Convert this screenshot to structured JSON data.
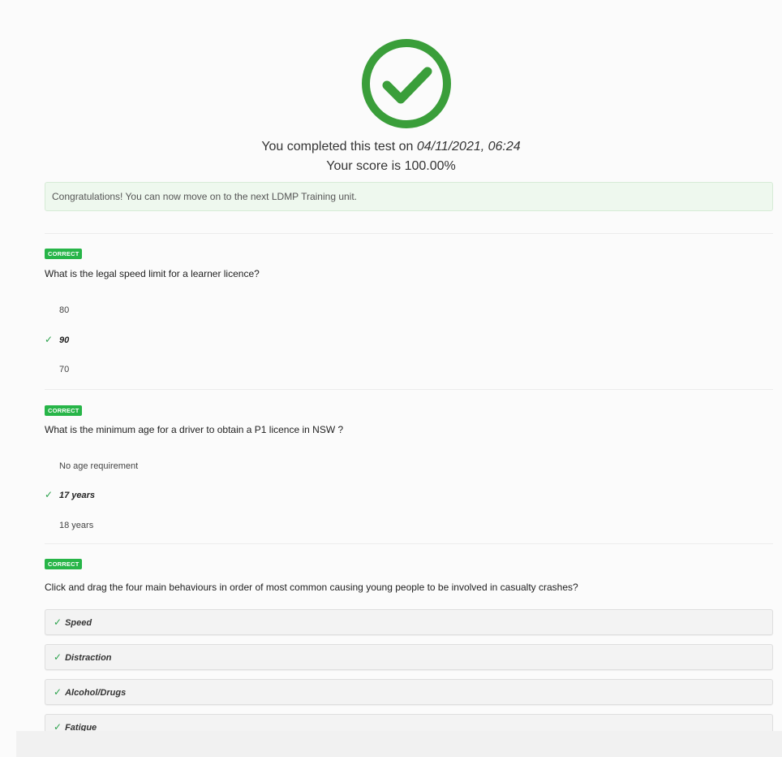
{
  "result": {
    "icon": "check-circle-icon",
    "completed_prefix": "You completed this test on ",
    "completed_date": "04/11/2021, 06:24",
    "score_text": "Your score is 100.00%"
  },
  "alert": {
    "message": "Congratulations! You can now move on to the next LDMP Training unit."
  },
  "questions": [
    {
      "status": "CORRECT",
      "text": "What is the legal speed limit for a learner licence?",
      "answers": [
        "80",
        "90",
        "70"
      ],
      "selected": "90"
    },
    {
      "status": "CORRECT",
      "text": "What is the minimum age for a driver to obtain a P1 licence in NSW ?",
      "answers": [
        "No age requirement",
        "17 years",
        "18 years"
      ],
      "selected": "17 years"
    },
    {
      "status": "CORRECT",
      "text": "Click and drag the four main behaviours in order of most common causing young people to be involved in casualty crashes?",
      "items": [
        "Speed",
        "Distraction",
        "Alcohol/Drugs",
        "Fatigue"
      ]
    }
  ],
  "colors": {
    "success": "#27b548",
    "check_icon": "#3a9e3a",
    "alert_bg": "#eef8ee"
  }
}
